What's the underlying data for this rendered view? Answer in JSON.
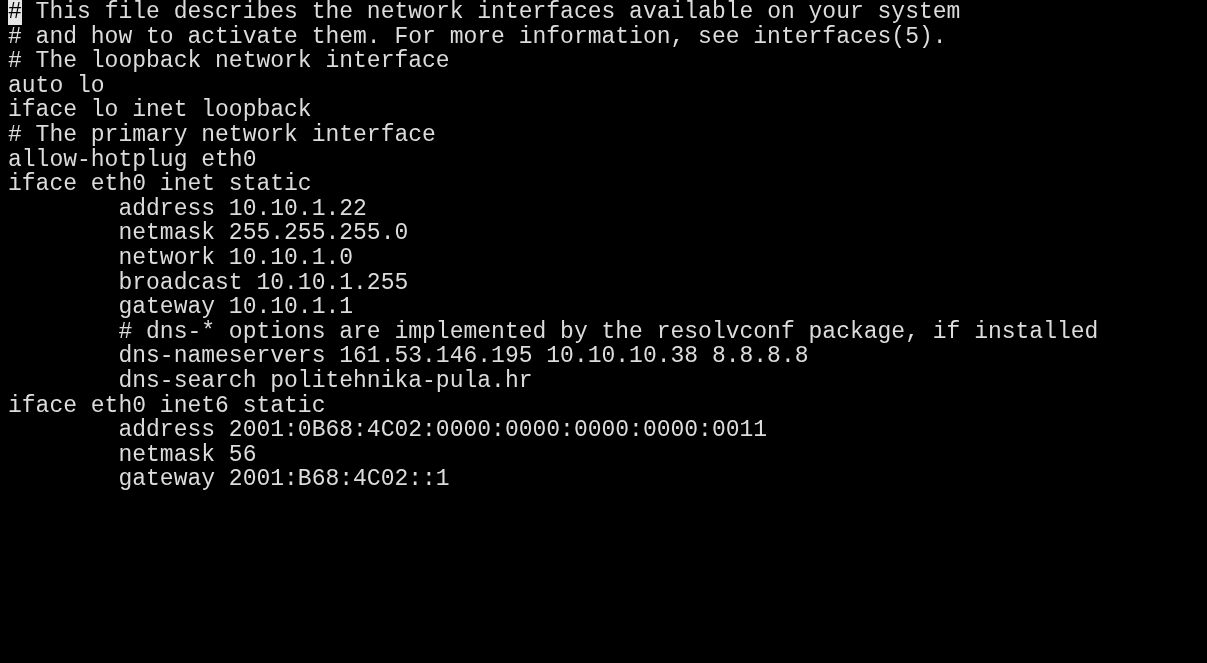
{
  "terminal": {
    "lines": [
      {
        "text": "# This file describes the network interfaces available on your system",
        "cursor": true
      },
      {
        "text": "# and how to activate them. For more information, see interfaces(5).",
        "cursor": false
      },
      {
        "text": "# The loopback network interface",
        "cursor": false
      },
      {
        "text": "auto lo",
        "cursor": false
      },
      {
        "text": "iface lo inet loopback",
        "cursor": false
      },
      {
        "text": "# The primary network interface",
        "cursor": false
      },
      {
        "text": "allow-hotplug eth0",
        "cursor": false
      },
      {
        "text": "iface eth0 inet static",
        "cursor": false
      },
      {
        "text": "        address 10.10.1.22",
        "cursor": false
      },
      {
        "text": "        netmask 255.255.255.0",
        "cursor": false
      },
      {
        "text": "        network 10.10.1.0",
        "cursor": false
      },
      {
        "text": "        broadcast 10.10.1.255",
        "cursor": false
      },
      {
        "text": "        gateway 10.10.1.1",
        "cursor": false
      },
      {
        "text": "        # dns-* options are implemented by the resolvconf package, if installed",
        "cursor": false
      },
      {
        "text": "        dns-nameservers 161.53.146.195 10.10.10.38 8.8.8.8",
        "cursor": false
      },
      {
        "text": "        dns-search politehnika-pula.hr",
        "cursor": false
      },
      {
        "text": "iface eth0 inet6 static",
        "cursor": false
      },
      {
        "text": "        address 2001:0B68:4C02:0000:0000:0000:0000:0011",
        "cursor": false
      },
      {
        "text": "        netmask 56",
        "cursor": false
      },
      {
        "text": "        gateway 2001:B68:4C02::1",
        "cursor": false
      }
    ]
  }
}
